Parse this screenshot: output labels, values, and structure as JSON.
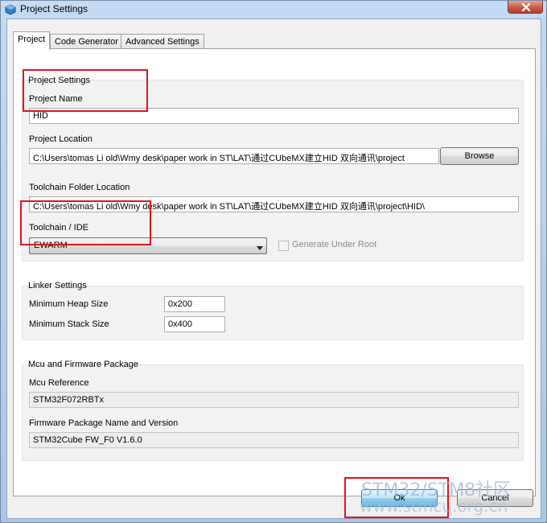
{
  "window": {
    "title": "Project Settings",
    "icon": "cube-app-icon",
    "close_icon": "close-icon"
  },
  "tabs": [
    {
      "label": "Project",
      "active": true
    },
    {
      "label": "Code Generator",
      "active": false
    },
    {
      "label": "Advanced Settings",
      "active": false
    }
  ],
  "project_settings": {
    "group_title": "Project Settings",
    "project_name_label": "Project Name",
    "project_name_value": "HID",
    "project_location_label": "Project Location",
    "project_location_value": "C:\\Users\\tomas Li old\\Wmy desk\\paper work in ST\\LAT\\通过CUbeMX建立HID 双向通讯\\project",
    "browse_label": "Browse",
    "toolchain_folder_label": "Toolchain Folder Location",
    "toolchain_folder_value": "C:\\Users\\tomas Li old\\Wmy desk\\paper work in ST\\LAT\\通过CUbeMX建立HID 双向通讯\\project\\HID\\",
    "toolchain_ide_label": "Toolchain / IDE",
    "toolchain_ide_value": "EWARM",
    "generate_under_root_label": "Generate Under Root",
    "generate_under_root_checked": false
  },
  "linker_settings": {
    "group_title": "Linker Settings",
    "min_heap_label": "Minimum Heap Size",
    "min_heap_value": "0x200",
    "min_stack_label": "Minimum Stack Size",
    "min_stack_value": "0x400"
  },
  "mcu_firmware": {
    "group_title": "Mcu and Firmware Package",
    "mcu_reference_label": "Mcu Reference",
    "mcu_reference_value": "STM32F072RBTx",
    "firmware_label": "Firmware Package Name and Version",
    "firmware_value": "STM32Cube FW_F0 V1.6.0"
  },
  "footer": {
    "ok_label": "Ok",
    "cancel_label": "Cancel"
  },
  "watermark": {
    "line1": "STM32/STM8社区",
    "line2": "www.stmcu.org.cn"
  },
  "colors": {
    "highlight": "#e0141e",
    "accent": "#3c7fb1"
  }
}
